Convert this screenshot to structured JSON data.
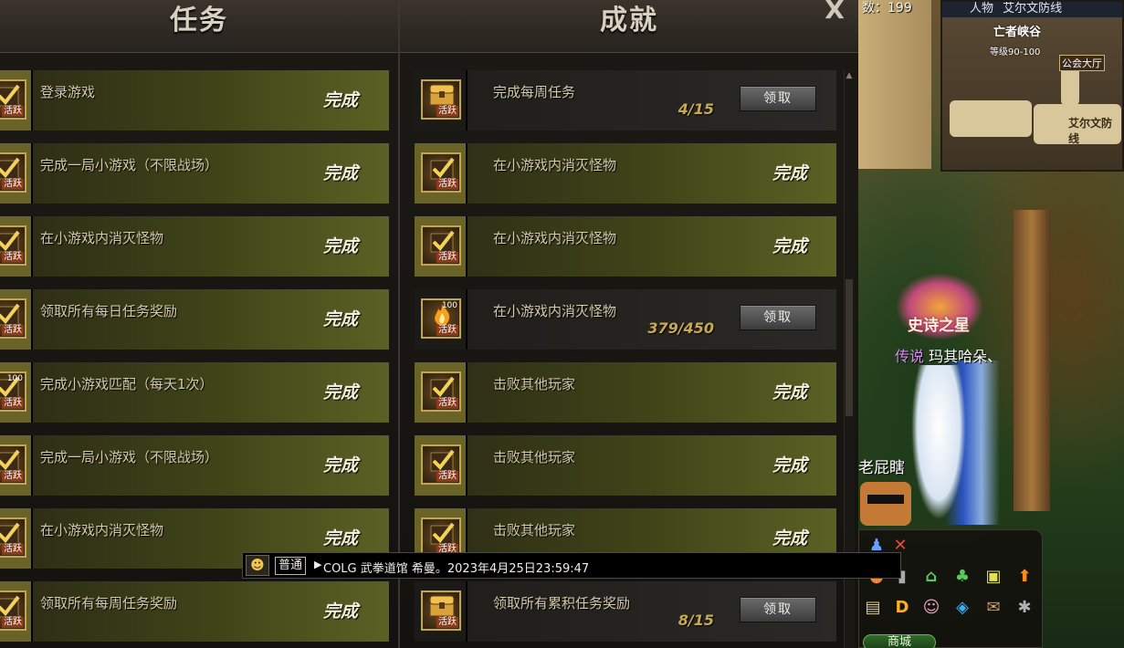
{
  "panel": {
    "left_header": "任务",
    "right_header": "成就",
    "close_label": "X"
  },
  "left_rows": [
    {
      "title": "登录游戏",
      "status": "完成",
      "icon": "check-reward-icon",
      "tag": "活跃"
    },
    {
      "title": "完成一局小游戏（不限战场）",
      "status": "完成",
      "icon": "check-reward-icon",
      "tag": "活跃"
    },
    {
      "title": "在小游戏内消灭怪物",
      "status": "完成",
      "icon": "check-reward-icon",
      "tag": "活跃"
    },
    {
      "title": "领取所有每日任务奖励",
      "status": "完成",
      "icon": "check-reward-icon",
      "tag": "活跃"
    },
    {
      "title": "完成小游戏匹配（每天1次）",
      "status": "完成",
      "icon": "check-reward-icon",
      "tag": "活跃",
      "badge": "100"
    },
    {
      "title": "完成一局小游戏（不限战场）",
      "status": "完成",
      "icon": "check-reward-icon",
      "tag": "活跃"
    },
    {
      "title": "在小游戏内消灭怪物",
      "status": "完成",
      "icon": "check-reward-icon",
      "tag": "活跃"
    },
    {
      "title": "领取所有每周任务奖励",
      "status": "完成",
      "icon": "check-reward-icon",
      "tag": "活跃"
    }
  ],
  "right_rows": [
    {
      "title": "完成每周任务",
      "state": "claim",
      "progress": "4/15",
      "button": "领取",
      "icon": "chest-icon",
      "tag": "活跃"
    },
    {
      "title": "在小游戏内消灭怪物",
      "state": "done",
      "status": "完成",
      "icon": "check-reward-icon",
      "tag": "活跃"
    },
    {
      "title": "在小游戏内消灭怪物",
      "state": "done",
      "status": "完成",
      "icon": "check-reward-icon",
      "tag": "活跃"
    },
    {
      "title": "在小游戏内消灭怪物",
      "state": "claim",
      "progress": "379/450",
      "button": "领取",
      "icon": "fire-reward-icon",
      "tag": "活跃",
      "badge": "100"
    },
    {
      "title": "击败其他玩家",
      "state": "done",
      "status": "完成",
      "icon": "check-reward-icon",
      "tag": "活跃"
    },
    {
      "title": "击败其他玩家",
      "state": "done",
      "status": "完成",
      "icon": "check-reward-icon",
      "tag": "活跃"
    },
    {
      "title": "击败其他玩家",
      "state": "done",
      "status": "完成",
      "icon": "check-reward-icon",
      "tag": "活跃"
    },
    {
      "title": "领取所有累积任务奖励",
      "state": "claim",
      "progress": "8/15",
      "button": "领取",
      "icon": "chest-icon",
      "tag": "活跃"
    }
  ],
  "chat": {
    "channel": "普通",
    "message": "COLG 武拳道馆 希曼。2023年4月25日23:59:47"
  },
  "world": {
    "stat_label": "数：199",
    "minimap_tab": "人物",
    "minimap_area": "艾尔文防线",
    "minimap_zone": "亡者峡谷",
    "minimap_level": "等级90-100",
    "minimap_guild": "公会大厅",
    "minimap_town": "艾尔文防线",
    "title_badge": "史诗之星",
    "player_rank": "传说",
    "player_name": "玛其哈朵、",
    "npc_name": "老屁瞎",
    "shop_label": "商城"
  },
  "colors": {
    "done_row": "#5a6124",
    "claim_row": "#2b2926",
    "gold_border": "#c2a64a",
    "progress_text": "#c8a950"
  }
}
